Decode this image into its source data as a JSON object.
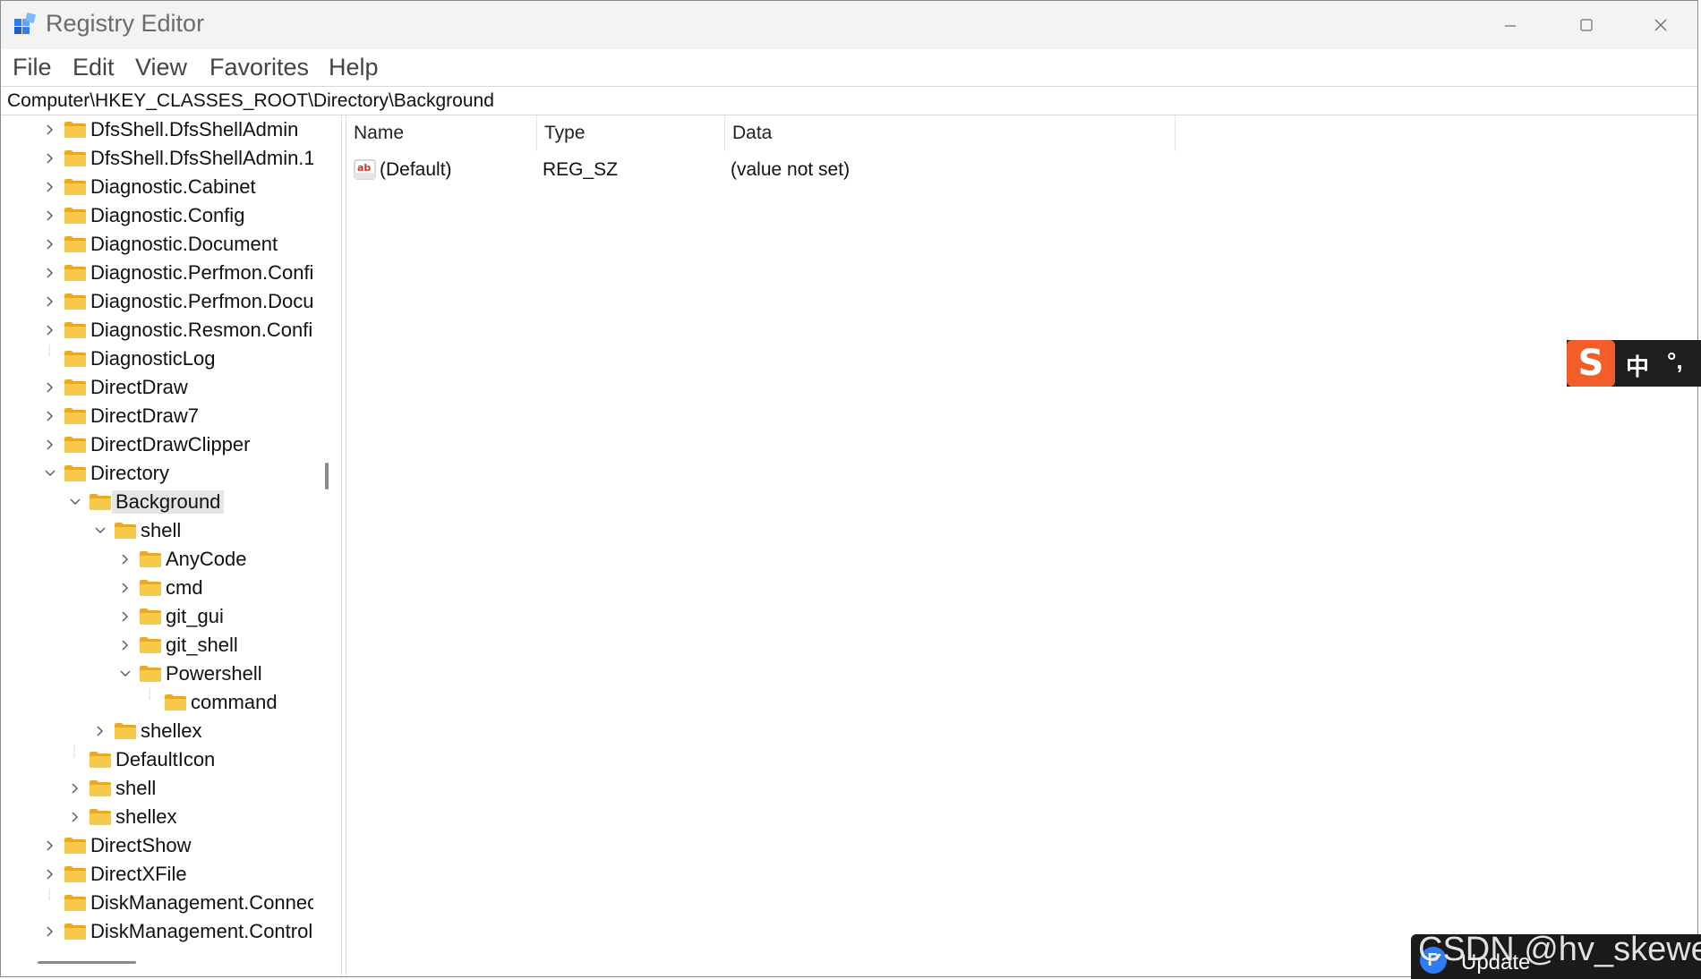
{
  "window": {
    "title": "Registry Editor",
    "controls": {
      "minimize": "minimize-icon",
      "maximize": "maximize-icon",
      "close": "close-icon"
    }
  },
  "menu": [
    "File",
    "Edit",
    "View",
    "Favorites",
    "Help"
  ],
  "address": "Computer\\HKEY_CLASSES_ROOT\\Directory\\Background",
  "tree": [
    {
      "label": "DfsShell.DfsShellAdmin",
      "depth": 0,
      "expander": "collapsed"
    },
    {
      "label": "DfsShell.DfsShellAdmin.1",
      "depth": 0,
      "expander": "collapsed"
    },
    {
      "label": "Diagnostic.Cabinet",
      "depth": 0,
      "expander": "collapsed"
    },
    {
      "label": "Diagnostic.Config",
      "depth": 0,
      "expander": "collapsed"
    },
    {
      "label": "Diagnostic.Document",
      "depth": 0,
      "expander": "collapsed"
    },
    {
      "label": "Diagnostic.Perfmon.Config",
      "depth": 0,
      "expander": "collapsed"
    },
    {
      "label": "Diagnostic.Perfmon.Docum",
      "depth": 0,
      "expander": "collapsed"
    },
    {
      "label": "Diagnostic.Resmon.Config",
      "depth": 0,
      "expander": "collapsed"
    },
    {
      "label": "DiagnosticLog",
      "depth": 0,
      "expander": "none"
    },
    {
      "label": "DirectDraw",
      "depth": 0,
      "expander": "collapsed"
    },
    {
      "label": "DirectDraw7",
      "depth": 0,
      "expander": "collapsed"
    },
    {
      "label": "DirectDrawClipper",
      "depth": 0,
      "expander": "collapsed"
    },
    {
      "label": "Directory",
      "depth": 0,
      "expander": "expanded"
    },
    {
      "label": "Background",
      "depth": 1,
      "expander": "expanded",
      "selected": true
    },
    {
      "label": "shell",
      "depth": 2,
      "expander": "expanded"
    },
    {
      "label": "AnyCode",
      "depth": 3,
      "expander": "collapsed"
    },
    {
      "label": "cmd",
      "depth": 3,
      "expander": "collapsed"
    },
    {
      "label": "git_gui",
      "depth": 3,
      "expander": "collapsed"
    },
    {
      "label": "git_shell",
      "depth": 3,
      "expander": "collapsed"
    },
    {
      "label": "Powershell",
      "depth": 3,
      "expander": "expanded"
    },
    {
      "label": "command",
      "depth": 4,
      "expander": "none"
    },
    {
      "label": "shellex",
      "depth": 2,
      "expander": "collapsed"
    },
    {
      "label": "DefaultIcon",
      "depth": 1,
      "expander": "none"
    },
    {
      "label": "shell",
      "depth": 1,
      "expander": "collapsed"
    },
    {
      "label": "shellex",
      "depth": 1,
      "expander": "collapsed"
    },
    {
      "label": "DirectShow",
      "depth": 0,
      "expander": "collapsed"
    },
    {
      "label": "DirectXFile",
      "depth": 0,
      "expander": "collapsed"
    },
    {
      "label": "DiskManagement.Connect",
      "depth": 0,
      "expander": "none"
    },
    {
      "label": "DiskManagement.Control",
      "depth": 0,
      "expander": "collapsed"
    }
  ],
  "list": {
    "columns": [
      "Name",
      "Type",
      "Data"
    ],
    "rows": [
      {
        "icon": "string-value-icon",
        "name": "(Default)",
        "type": "REG_SZ",
        "data": "(value not set)"
      }
    ]
  },
  "ime": {
    "logo": "S",
    "mode": "中",
    "punct": "°,"
  },
  "update_badge": {
    "label": "Update",
    "icon": "P"
  },
  "watermark": "CSDN @hv_skewer",
  "colors": {
    "folder": "#f7c948",
    "folder_dark": "#e8a925",
    "selection": "#e5e5e5",
    "ime_accent": "#f25d2a"
  }
}
